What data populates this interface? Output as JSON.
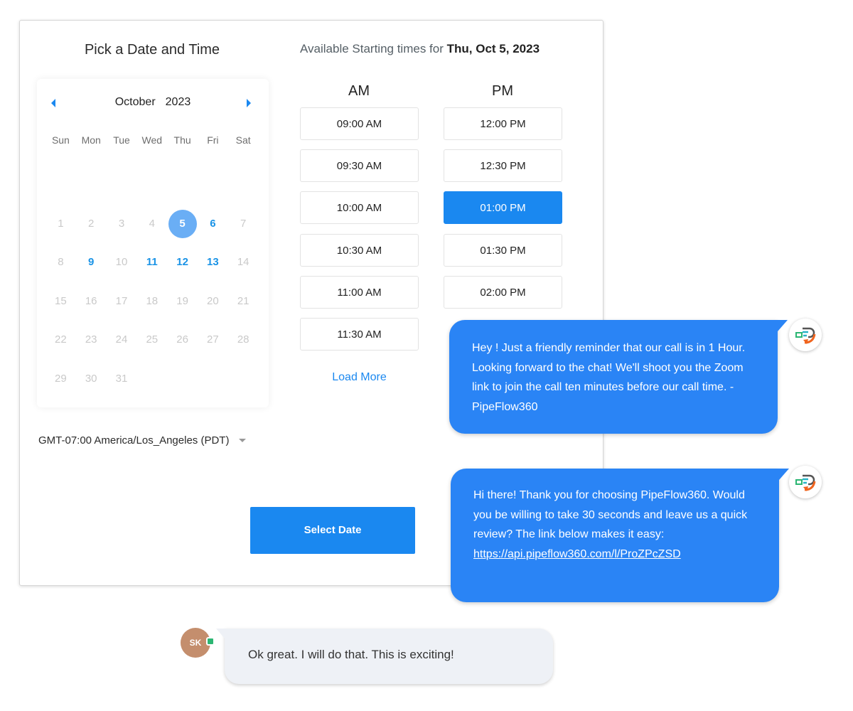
{
  "scheduler": {
    "title": "Pick a Date and Time",
    "calendar": {
      "month": "October",
      "year": "2023",
      "weekdays": [
        "Sun",
        "Mon",
        "Tue",
        "Wed",
        "Thu",
        "Fri",
        "Sat"
      ],
      "weeks": [
        [
          "1",
          "2",
          "3",
          "4",
          "5",
          "6",
          "7"
        ],
        [
          "8",
          "9",
          "10",
          "11",
          "12",
          "13",
          "14"
        ],
        [
          "15",
          "16",
          "17",
          "18",
          "19",
          "20",
          "21"
        ],
        [
          "22",
          "23",
          "24",
          "25",
          "26",
          "27",
          "28"
        ],
        [
          "29",
          "30",
          "31",
          "",
          "",
          "",
          ""
        ]
      ],
      "selected_day": "5",
      "available_days": [
        "6",
        "9",
        "11",
        "12",
        "13"
      ]
    },
    "timezone": "GMT-07:00 America/Los_Angeles (PDT)",
    "available_prefix": "Available Starting times for",
    "available_date": "Thu, Oct 5, 2023",
    "am_label": "AM",
    "pm_label": "PM",
    "am_slots": [
      "09:00 AM",
      "09:30 AM",
      "10:00 AM",
      "10:30 AM",
      "11:00 AM",
      "11:30 AM"
    ],
    "pm_slots": [
      "12:00 PM",
      "12:30 PM",
      "01:00 PM",
      "01:30 PM",
      "02:00 PM"
    ],
    "selected_slot": "01:00 PM",
    "load_more": "Load More",
    "select_button": "Select Date"
  },
  "chat": {
    "bot_message_1": "Hey ! Just a friendly reminder that our call is in 1 Hour. Looking forward to the chat! We'll shoot you the Zoom link to join the call ten minutes before our call time. - PipeFlow360",
    "bot_message_2_text": "Hi there! Thank you for choosing PipeFlow360. Would you be willing to take 30 seconds and leave us a quick review? The link below makes it easy:",
    "bot_message_2_link": "https://api.pipeflow360.com/l/ProZPcZSD",
    "user_initials": "SK",
    "user_message": "Ok great. I will do that. This is exciting!"
  },
  "colors": {
    "accent": "#1a88f0",
    "bubble": "#2a84f5",
    "selected_day": "#6aaef5",
    "available_day": "#1a93e6"
  }
}
